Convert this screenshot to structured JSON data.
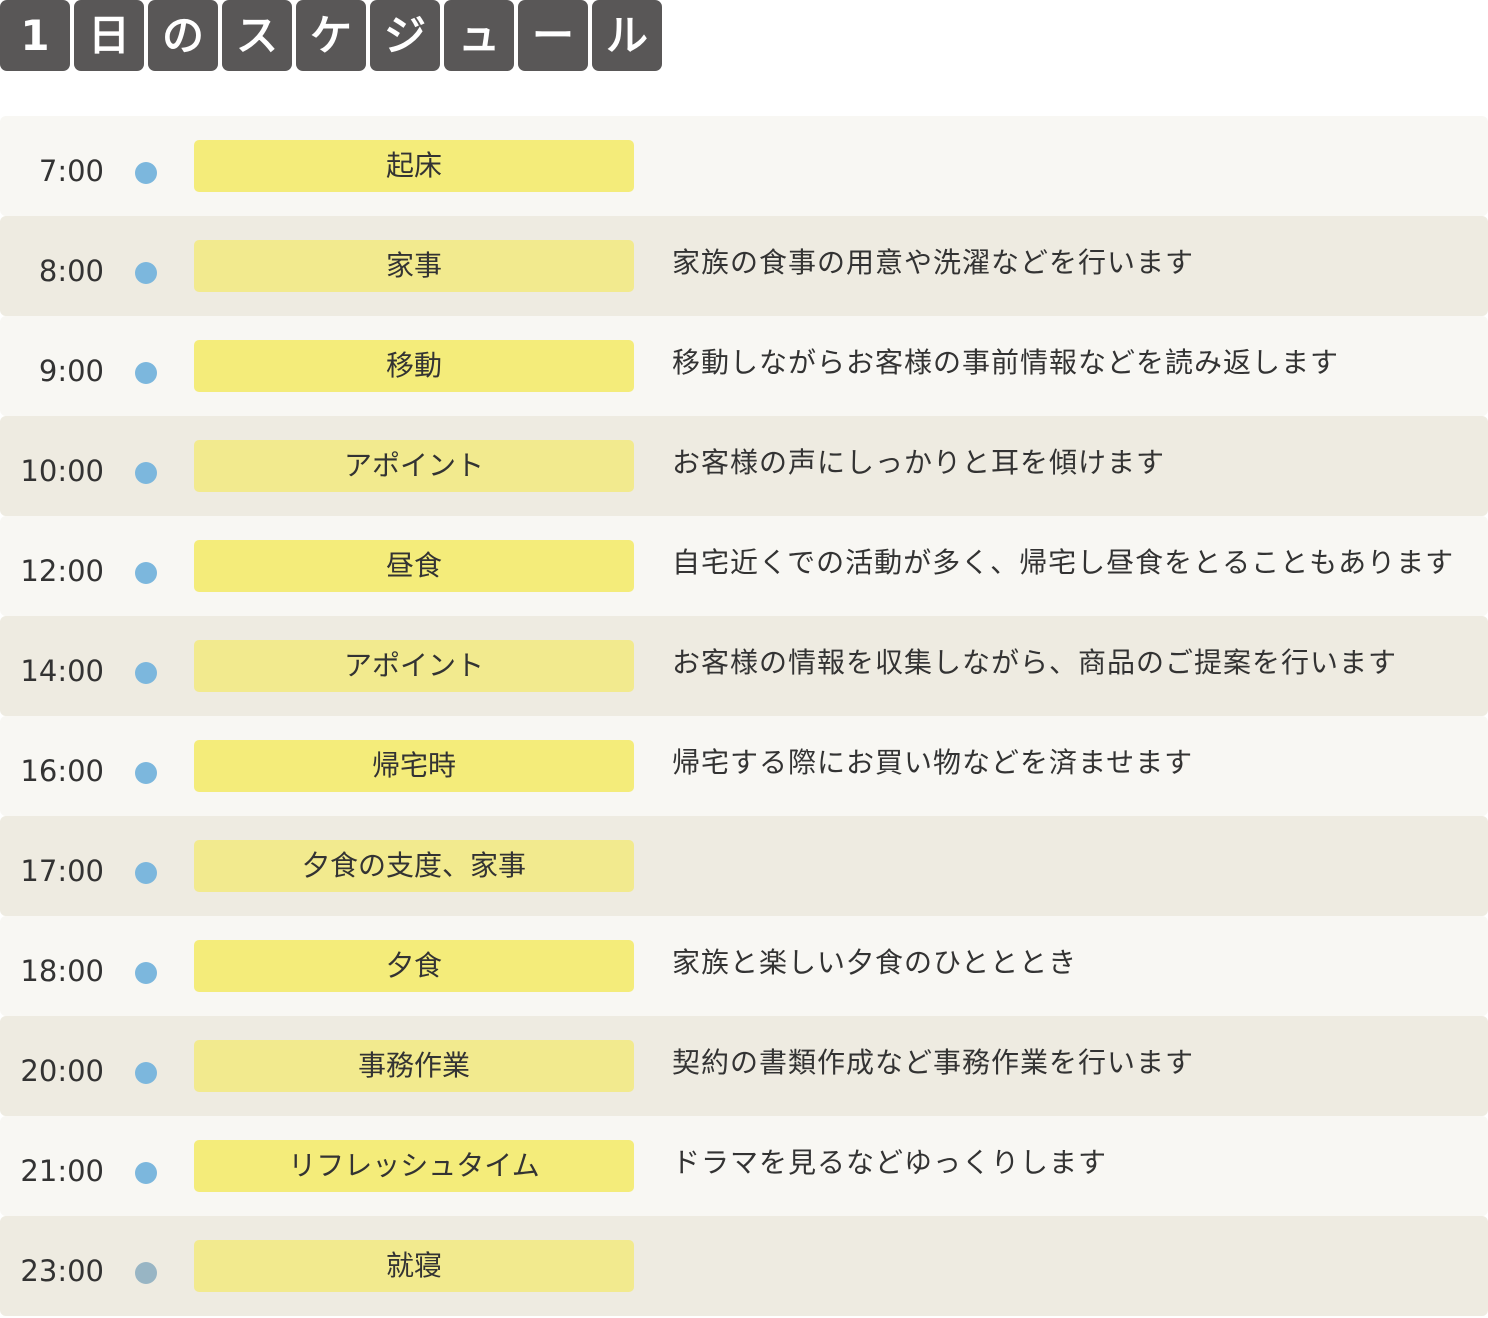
{
  "title": {
    "chars": [
      "1",
      "日",
      "の",
      "ス",
      "ケ",
      "ジ",
      "ュ",
      "ー",
      "ル"
    ]
  },
  "schedule": [
    {
      "time": "7:00",
      "activity": "起床",
      "description": ""
    },
    {
      "time": "8:00",
      "activity": "家事",
      "description": "家族の食事の用意や洗濯などを行います"
    },
    {
      "time": "9:00",
      "activity": "移動",
      "description": "移動しながらお客様の事前情報などを読み返します"
    },
    {
      "time": "10:00",
      "activity": "アポイント",
      "description": "お客様の声にしっかりと耳を傾けます"
    },
    {
      "time": "12:00",
      "activity": "昼食",
      "description": "自宅近くでの活動が多く、帰宅し昼食をとることもあります"
    },
    {
      "time": "14:00",
      "activity": "アポイント",
      "description": "お客様の情報を収集しながら、商品のご提案を行います"
    },
    {
      "time": "16:00",
      "activity": "帰宅時",
      "description": "帰宅する際にお買い物などを済ませます"
    },
    {
      "time": "17:00",
      "activity": "夕食の支度、家事",
      "description": ""
    },
    {
      "time": "18:00",
      "activity": "夕食",
      "description": "家族と楽しい夕食のひとととき"
    },
    {
      "time": "20:00",
      "activity": "事務作業",
      "description": "契約の書類作成など事務作業を行います"
    },
    {
      "time": "21:00",
      "activity": "リフレッシュタイム",
      "description": "ドラマを見るなどゆっくりします"
    },
    {
      "time": "23:00",
      "activity": "就寝",
      "description": ""
    }
  ],
  "colors": {
    "title_tile": "#595757",
    "row_light": "#f8f7f3",
    "row_dark": "#eeebe1",
    "activity_box": "#f4ec7a",
    "timeline_dot": "#7cb7dd",
    "timeline_line": "#8b7d6e"
  }
}
